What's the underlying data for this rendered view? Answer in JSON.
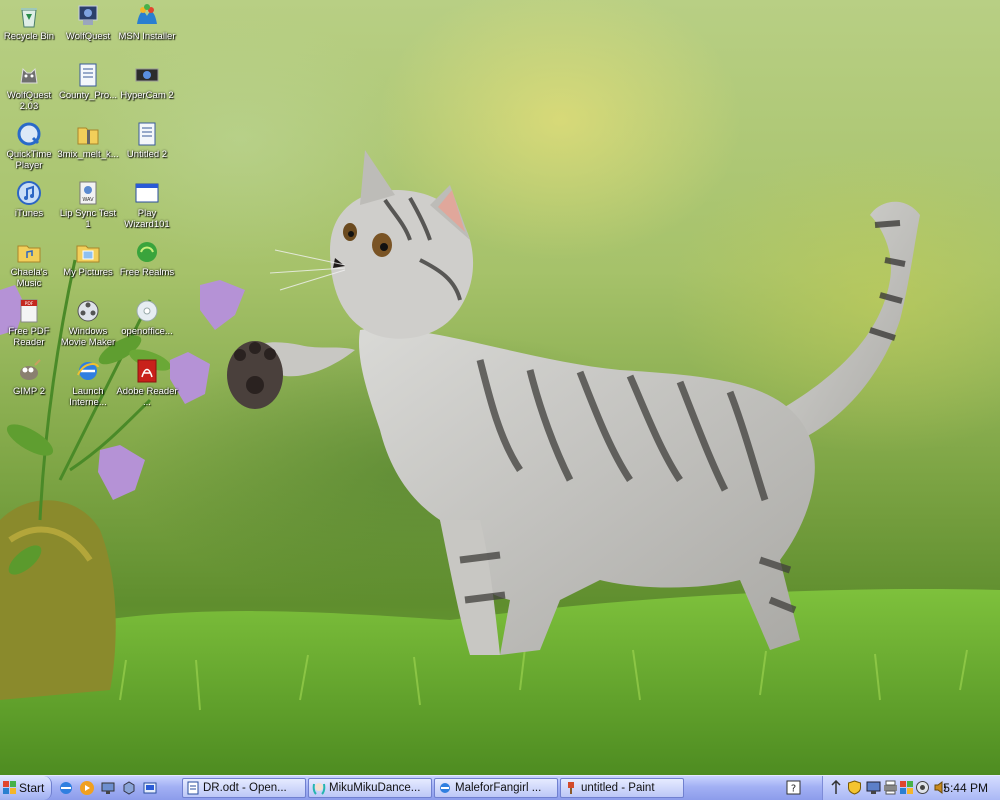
{
  "desktop": {
    "icons": [
      {
        "label": "Recycle Bin",
        "icon": "recycle-bin-icon"
      },
      {
        "label": "WolfQuest",
        "icon": "wolfquest-icon"
      },
      {
        "label": "MSN Installer",
        "icon": "msn-icon"
      },
      {
        "label": "WolfQuest 2.03",
        "icon": "wolfquest-icon"
      },
      {
        "label": "County_Pro...",
        "icon": "document-icon"
      },
      {
        "label": "HyperCam 2",
        "icon": "hypercam-icon"
      },
      {
        "label": "QuickTime Player",
        "icon": "quicktime-icon"
      },
      {
        "label": "3mix_melt_k...",
        "icon": "folder-zip-icon"
      },
      {
        "label": "Untitled 2",
        "icon": "document-icon"
      },
      {
        "label": "iTunes",
        "icon": "itunes-icon"
      },
      {
        "label": "Lip Sync Test 1",
        "icon": "wav-file-icon"
      },
      {
        "label": "Play Wizard101",
        "icon": "window-shortcut-icon"
      },
      {
        "label": "Chaela's Music",
        "icon": "music-folder-icon"
      },
      {
        "label": "My Pictures",
        "icon": "pictures-folder-icon"
      },
      {
        "label": "Free Realms",
        "icon": "free-realms-icon"
      },
      {
        "label": "Free PDF Reader",
        "icon": "pdf-icon"
      },
      {
        "label": "Windows Movie Maker",
        "icon": "movie-maker-icon"
      },
      {
        "label": "openoffice...",
        "icon": "cd-icon"
      },
      {
        "label": "GIMP 2",
        "icon": "gimp-icon"
      },
      {
        "label": "Launch Interne...",
        "icon": "internet-explorer-icon"
      },
      {
        "label": "Adobe Reader ...",
        "icon": "adobe-reader-icon"
      }
    ]
  },
  "taskbar": {
    "start_label": "Start",
    "quick_launch": [
      "internet-explorer-icon",
      "media-player-icon",
      "network-icon",
      "app-icon",
      "show-desktop-icon"
    ],
    "tasks": [
      {
        "label": "DR.odt - Open...",
        "icon": "openoffice-icon"
      },
      {
        "label": "MikuMikuDance...",
        "icon": "miku-icon"
      },
      {
        "label": "MaleforFangirl ...",
        "icon": "internet-explorer-icon"
      },
      {
        "label": "untitled - Paint",
        "icon": "paint-icon"
      }
    ],
    "tray_icons": [
      "help-icon",
      "updates-icon",
      "security-shield-icon",
      "network-icon",
      "printer-icon",
      "color-icon",
      "camera-icon",
      "volume-icon"
    ],
    "clock": "5:44 PM"
  },
  "colors": {
    "taskbar": "#a2b0f4",
    "accent": "#2a5bd7"
  }
}
